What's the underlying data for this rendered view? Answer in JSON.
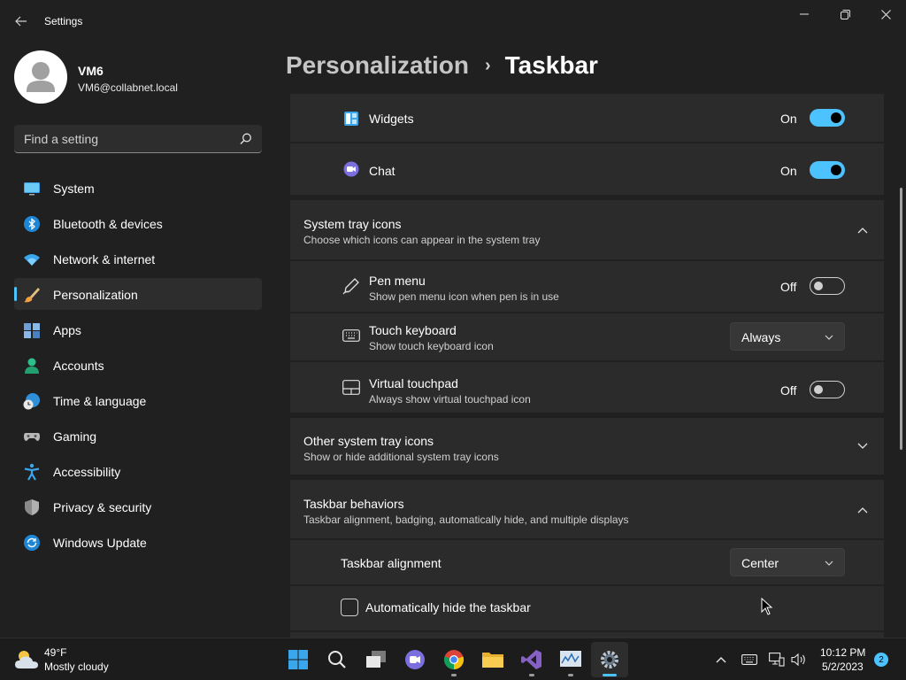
{
  "window": {
    "title": "Settings",
    "back_icon": "arrow-left-icon",
    "minimize_icon": "minimize-icon",
    "maximize_icon": "restore-icon",
    "close_icon": "close-icon"
  },
  "profile": {
    "name": "VM6",
    "email": "VM6@collabnet.local"
  },
  "search": {
    "placeholder": "Find a setting",
    "value": ""
  },
  "sidebar": {
    "items": [
      {
        "label": "System",
        "icon": "monitor-icon",
        "active": false
      },
      {
        "label": "Bluetooth & devices",
        "icon": "bluetooth-icon",
        "active": false
      },
      {
        "label": "Network & internet",
        "icon": "wifi-icon",
        "active": false
      },
      {
        "label": "Personalization",
        "icon": "brush-icon",
        "active": true
      },
      {
        "label": "Apps",
        "icon": "apps-icon",
        "active": false
      },
      {
        "label": "Accounts",
        "icon": "person-icon",
        "active": false
      },
      {
        "label": "Time & language",
        "icon": "globe-clock-icon",
        "active": false
      },
      {
        "label": "Gaming",
        "icon": "gamepad-icon",
        "active": false
      },
      {
        "label": "Accessibility",
        "icon": "accessibility-icon",
        "active": false
      },
      {
        "label": "Privacy & security",
        "icon": "shield-icon",
        "active": false
      },
      {
        "label": "Windows Update",
        "icon": "update-icon",
        "active": false
      }
    ]
  },
  "header": {
    "parent": "Personalization",
    "separator": "›",
    "current": "Taskbar"
  },
  "taskbar_items": {
    "widgets": {
      "label": "Widgets",
      "state": "On",
      "icon": "widgets-icon"
    },
    "chat": {
      "label": "Chat",
      "state": "On",
      "icon": "chat-icon"
    }
  },
  "system_tray": {
    "title": "System tray icons",
    "subtitle": "Choose which icons can appear in the system tray",
    "expanded": true,
    "pen_menu": {
      "title": "Pen menu",
      "subtitle": "Show pen menu icon when pen is in use",
      "state": "Off",
      "icon": "pen-icon"
    },
    "touch_keyboard": {
      "title": "Touch keyboard",
      "subtitle": "Show touch keyboard icon",
      "value": "Always",
      "icon": "keyboard-icon"
    },
    "virtual_touchpad": {
      "title": "Virtual touchpad",
      "subtitle": "Always show virtual touchpad icon",
      "state": "Off",
      "icon": "touchpad-icon"
    }
  },
  "other_tray": {
    "title": "Other system tray icons",
    "subtitle": "Show or hide additional system tray icons",
    "expanded": false
  },
  "behaviors": {
    "title": "Taskbar behaviors",
    "subtitle": "Taskbar alignment, badging, automatically hide, and multiple displays",
    "expanded": true,
    "alignment": {
      "label": "Taskbar alignment",
      "value": "Center"
    },
    "auto_hide": {
      "label": "Automatically hide the taskbar",
      "checked": false
    }
  },
  "os_taskbar": {
    "weather": {
      "temp": "49°F",
      "desc": "Mostly cloudy",
      "icon": "cloud-sun-icon"
    },
    "clock": {
      "time": "10:12 PM",
      "date": "5/2/2023"
    },
    "notifications": "2",
    "apps": [
      "windows-start-icon",
      "search-icon",
      "task-view-icon",
      "teams-chat-icon",
      "chrome-icon",
      "file-explorer-icon",
      "visual-studio-icon",
      "resource-monitor-icon",
      "settings-gear-icon"
    ],
    "tray": [
      "chevron-up-icon",
      "keyboard-icon",
      "network-icon",
      "volume-icon"
    ],
    "colors": {
      "accent": "#4cc2ff",
      "background": "#202020",
      "card": "#2b2b2b"
    }
  }
}
